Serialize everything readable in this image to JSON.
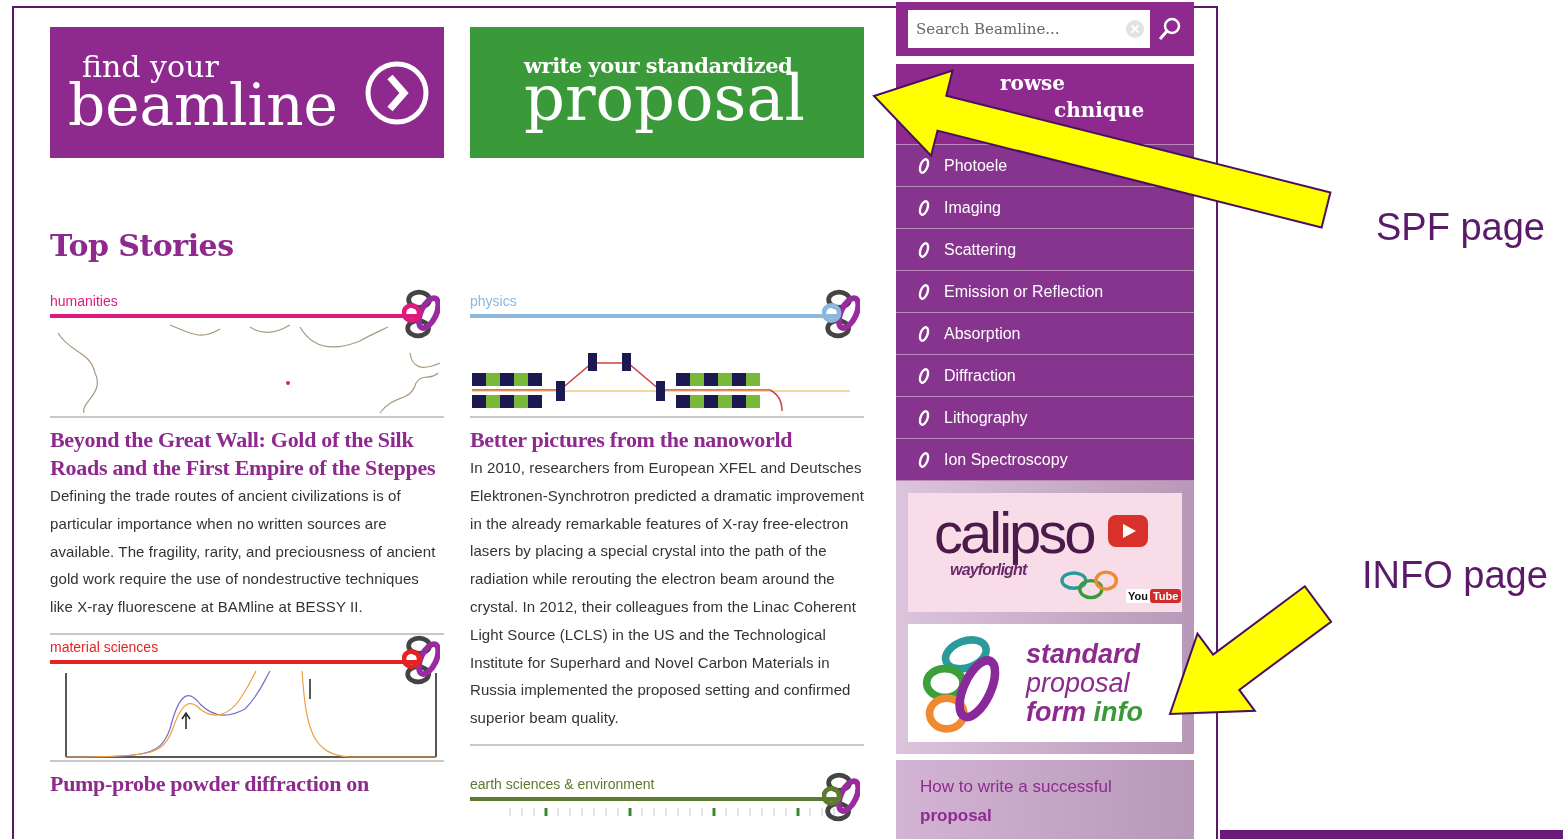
{
  "banners": [
    {
      "kind": "find",
      "small": "find your",
      "big": "beamline"
    },
    {
      "kind": "write",
      "small": "write your standardized",
      "big": "proposal"
    }
  ],
  "top_stories": {
    "heading": "Top Stories"
  },
  "columns": [
    [
      {
        "category": "humanities",
        "color": "#e0197d",
        "kind": "map",
        "title": "Beyond the Great Wall: Gold of the Silk Roads and the First Empire of the Steppes",
        "body": "Defining the trade routes of ancient civilizations is of particular importance when no written sources are available. The fragility, rarity, and preciousness of ancient gold work require the use of nondestructive techniques like X-ray fluorescene at BAMline at BESSY II."
      },
      {
        "category": "material sciences",
        "color": "#e52421",
        "kind": "plot",
        "title": "Pump-probe powder diffraction on"
      }
    ],
    [
      {
        "category": "physics",
        "color": "#8cb8e0",
        "kind": "undulator",
        "title": "Better pictures from the nanoworld",
        "body": "In 2010, researchers from European XFEL and Deutsches Elektronen-Synchrotron predicted a dramatic improvement in the already remarkable features of X-ray free-electron lasers by placing a special crystal into the path of the radiation while rerouting the electron beam around the crystal. In 2012, their colleagues from the Linac Coherent Light Source (LCLS) in the US and the Technological Institute for Superhard and Novel Carbon Materials in Russia implemented the proposed setting and confirmed superior beam quality."
      },
      {
        "category": "earth sciences & environment",
        "color": "#5e7a2c",
        "kind": "strip"
      }
    ]
  ],
  "sidebar": {
    "search": {
      "placeholder": "Search Beamline..."
    },
    "browse": [
      "rowse",
      "chnique"
    ],
    "items": [
      "Photoele",
      "Imaging",
      "Scattering",
      "Emission or Reflection",
      "Absorption",
      "Diffraction",
      "Lithography",
      "Ion Spectroscopy"
    ],
    "calipso": {
      "logo": "calipso",
      "tagline": "wayforlight",
      "badge": [
        "You",
        "Tube"
      ]
    },
    "spf_card": {
      "lines": [
        "standard",
        "proposal"
      ],
      "last": [
        "form",
        "info"
      ]
    },
    "link": "How to write a successful **proposal**"
  },
  "annotations": [
    {
      "label": "SPF page"
    },
    {
      "label": "INFO page"
    }
  ]
}
